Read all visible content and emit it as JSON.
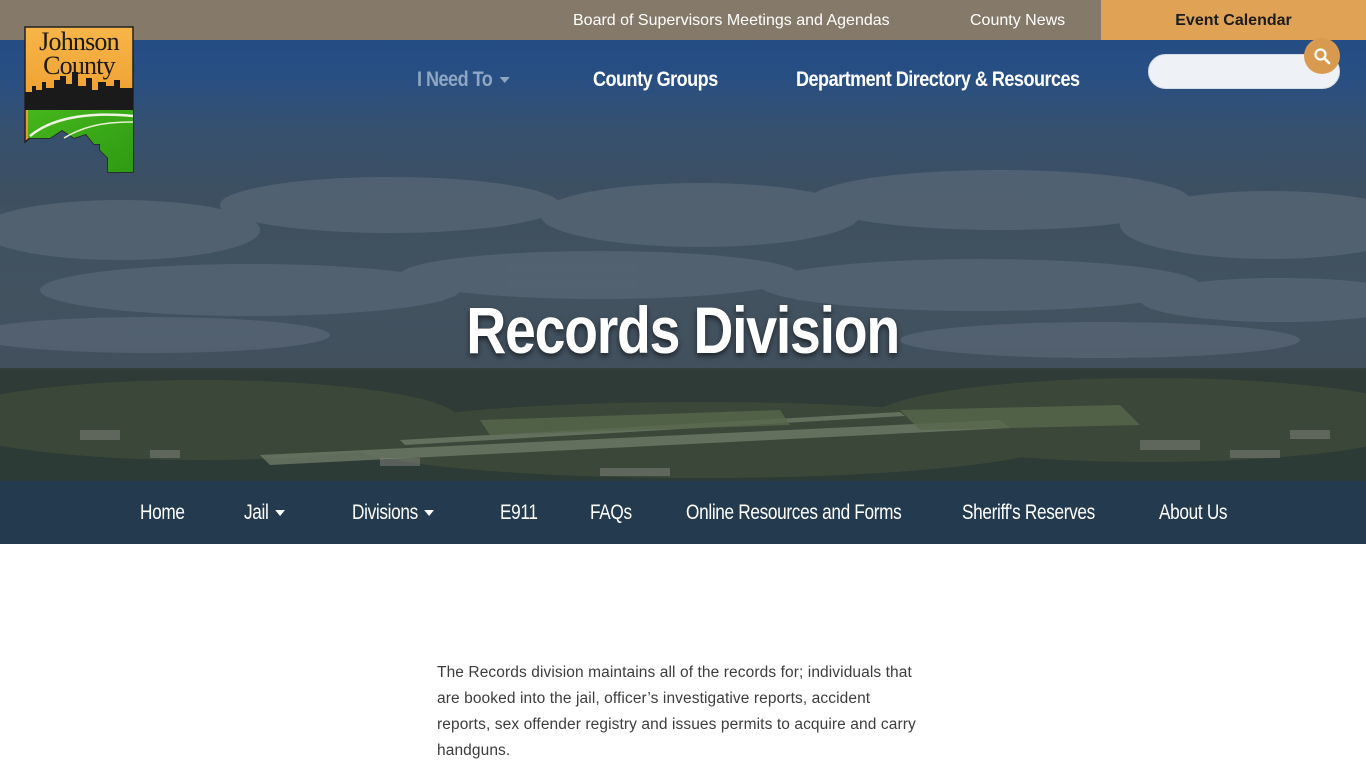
{
  "utility_bar": {
    "links": [
      {
        "label": "Board of Supervisors Meetings and Agendas"
      },
      {
        "label": "County News"
      }
    ],
    "event_calendar": "Event Calendar"
  },
  "logo": {
    "line1": "Johnson",
    "line2": "County"
  },
  "main_nav": {
    "items": [
      {
        "label": "I Need To",
        "has_dropdown": true
      },
      {
        "label": "County Groups"
      },
      {
        "label": "Department Directory & Resources"
      }
    ]
  },
  "search": {
    "placeholder": "",
    "icon": "search-icon"
  },
  "hero": {
    "title": "Records Division"
  },
  "sub_nav": {
    "items": [
      {
        "label": "Home"
      },
      {
        "label": "Jail",
        "has_dropdown": true
      },
      {
        "label": "Divisions",
        "has_dropdown": true
      },
      {
        "label": "E911"
      },
      {
        "label": "FAQs"
      },
      {
        "label": "Online Resources and Forms"
      },
      {
        "label": "Sheriff's Reserves"
      },
      {
        "label": "About Us"
      }
    ]
  },
  "content": {
    "paragraph": "The Records division maintains all of the records for; individuals that are booked into the jail, officer’s investigative reports, accident reports, sex offender registry and issues permits to acquire and carry handguns."
  },
  "colors": {
    "utility_bar": "#857a69",
    "event_calendar": "#e0a355",
    "search_button": "#d89a4f",
    "nav_muted": "#8fa6c3"
  }
}
